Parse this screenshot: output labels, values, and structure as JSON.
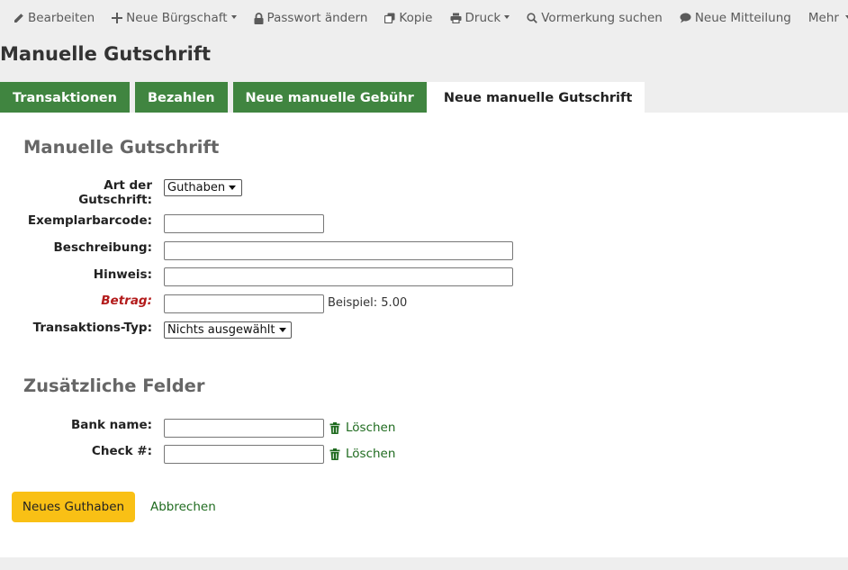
{
  "toolbar": {
    "edit": "Bearbeiten",
    "new_patron": "Neue Bürgschaft",
    "change_password": "Passwort ändern",
    "copy": "Kopie",
    "print": "Druck",
    "search_hold": "Vormerkung suchen",
    "new_message": "Neue Mitteilung",
    "more": "Mehr"
  },
  "page_title": "Manuelle Gutschrift",
  "tabs": [
    {
      "label": "Transaktionen",
      "active": false
    },
    {
      "label": "Bezahlen",
      "active": false
    },
    {
      "label": "Neue manuelle Gebühr",
      "active": false
    },
    {
      "label": "Neue manuelle Gutschrift",
      "active": true
    }
  ],
  "form": {
    "section_title": "Manuelle Gutschrift",
    "credit_type": {
      "label_line1": "Art der",
      "label_line2": "Gutschrift:",
      "value": "Guthaben"
    },
    "barcode": {
      "label": "Exemplarbarcode:",
      "value": ""
    },
    "description": {
      "label": "Beschreibung:",
      "value": ""
    },
    "note": {
      "label": "Hinweis:",
      "value": ""
    },
    "amount": {
      "label": "Betrag:",
      "value": "",
      "hint": "Beispiel: 5.00",
      "required": true
    },
    "transaction_type": {
      "label": "Transaktions-Typ:",
      "value": "Nichts ausgewählt"
    }
  },
  "additional": {
    "section_title": "Zusätzliche Felder",
    "fields": [
      {
        "label": "Bank name:",
        "value": "",
        "delete_label": "Löschen"
      },
      {
        "label": "Check #:",
        "value": "",
        "delete_label": "Löschen"
      }
    ]
  },
  "actions": {
    "submit_label": "Neues Guthaben",
    "cancel_label": "Abbrechen"
  },
  "colors": {
    "tab_green": "#408540",
    "link_green": "#1f6b1f",
    "primary_button": "#f9c015",
    "required_red": "#b31b1b"
  }
}
